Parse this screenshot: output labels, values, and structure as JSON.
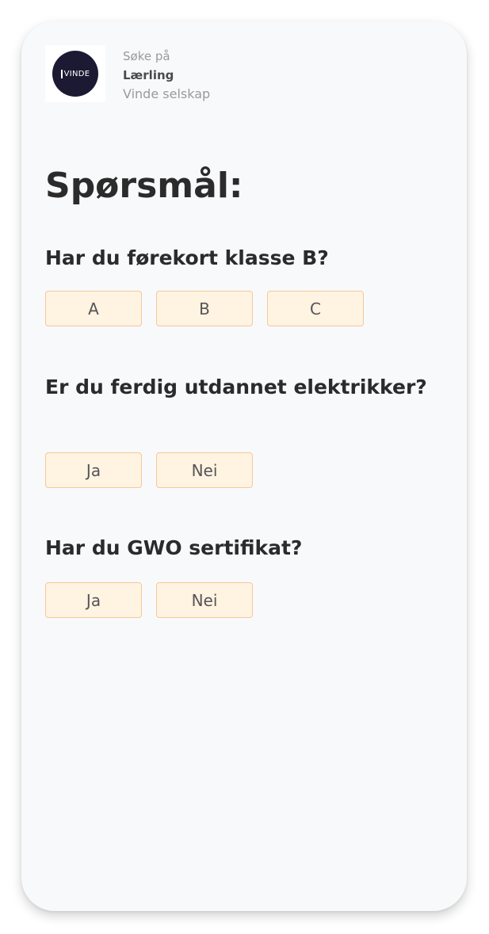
{
  "header": {
    "logo_text": "VINDE",
    "subtitle": "Søke på",
    "job_title": "Lærling",
    "company": "Vinde selskap"
  },
  "section_title": "Spørsmål:",
  "questions": [
    {
      "text": "Har du førekort klasse B?",
      "options": [
        "A",
        "B",
        "C"
      ]
    },
    {
      "text": "Er du ferdig utdannet elektrikker?",
      "options": [
        "Ja",
        "Nei"
      ]
    },
    {
      "text": "Har du GWO sertifikat?",
      "options": [
        "Ja",
        "Nei"
      ]
    }
  ],
  "colors": {
    "card_background": "#f8f9fb",
    "option_background": "#fff3e2",
    "option_border": "#f5c89a",
    "logo_background": "#1c1a33",
    "heading_text": "#2b2b2b",
    "muted_text": "#9a9a9a"
  }
}
